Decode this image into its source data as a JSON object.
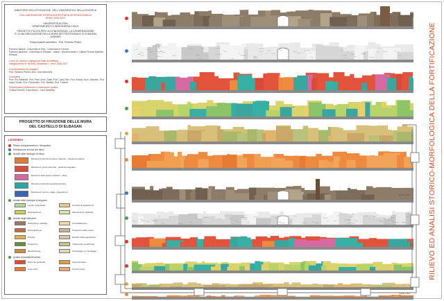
{
  "info": {
    "ministry": "MINISTERO DELL'ISTRUZIONE, DELL'UNIVERSITÀ E DELLA RICERCA",
    "collab_title": "COLLABORAZIONE INTERUNIVERSITARIA INTERNAZIONALE",
    "collab_year": "ANNO 2006-2007",
    "uni": "UNIVERSITÀ DI PISA",
    "dept": "DIPARTIMENTO DI INGEGNERIA CIVILE",
    "project_l1": "PROGETTO PILOTA PER LA CONOSCENZA, LA CONSERVAZIONE",
    "project_l2": "E LA VALORIZZAZIONE DELLA MURA SETTENTRIONALE DI ELBASAN",
    "project_l3": "- ALBANIA -",
    "resp": "Responsabile scientifico : Prof. Roberto Pierini",
    "partner_it": "Partners italiani : Università di Pisa - Università di Firenze",
    "partner_al": "Partners albanesi : Università di Elbasan - Istituti - Monumentale e Cultura Pisarra Mobilità - Elbasan",
    "course": "Corso di Laurea in Ingegneria Edile Architettura",
    "course2": "Insegnamento di Tecnica Urbanistica I - anno 2006-2007",
    "coord_hdr": "Coordinamento del progetto",
    "coord": "Prof. Roberto Pierini, Arch. Ivan Marchesi",
    "consult_hdr": "Consulenti",
    "consult": "Prof. Pio Saltarelli, Prof. Pani, Arch. Gatti, Prof. Carlo Ren, Prof. Bocca, Arch. Marrello, Prof. Ivano Scalzi, Prof. Pierandrei, Prof. Battisti, Prof. Tiratore",
    "prep_hdr": "Preparazione preliminare e restituzione grafica",
    "prep": "Chiara Erbolini, Francesca L. Luisi Samuele"
  },
  "project_title_l1": "PROGETTO DI FRUIZIONE DELLE MURA",
  "project_title_l2": "DEL CASTELLO DI ELBASAN",
  "legend": {
    "title": "LEGENDA",
    "dots": [
      {
        "label": "Rilievo fotogrammetrico / fotografico",
        "color": "#d33a2c"
      },
      {
        "label": "Restituzione tecnica dei rilievi",
        "color": "#3a77c4"
      },
      {
        "label": "Analisi delle tipologie di rilievo",
        "color": "#43a047"
      }
    ],
    "blocks": [
      {
        "color": "#e07a3a",
        "text": "Muratura in blocchi di pietra e laterizio - tessitura regolare"
      },
      {
        "color": "#d94a3a",
        "text": "Muratura in pietre sbozzate - tessitura irregolare"
      },
      {
        "color": "#d66aa0",
        "text": "Muratura mista pietra e laterizio - fasce"
      },
      {
        "color": "#2aa6a8",
        "text": "Muratura in blocchi squadrati di pietra"
      },
      {
        "color": "#3a64b0",
        "text": "Muratura in pietra e malta - integrazioni"
      }
    ],
    "degrado_hdr": "Analisi delle tipologie di degrado",
    "degrado": [
      {
        "a": "Lacune superficiali",
        "ca": "#b9d79a",
        "b": "Crescita di vegetazione",
        "cb": "#e8c98a"
      },
      {
        "a": "Disgregazione",
        "ca": "#c7d35a",
        "b": "Mancanza di materiale",
        "cb": "#d7e6a3"
      }
    ],
    "int_hdr": "Analisi degli interventi",
    "interventi": [
      {
        "a": "Stuccatura e stilatura",
        "ca": "#9e7a62",
        "b": "Consolidamento",
        "cb": "#f2d7b0"
      },
      {
        "a": "Reintegrazione",
        "ca": "#c56a3a",
        "b": "Protezione delle creste",
        "cb": "#cbb48a"
      },
      {
        "a": "Pulitura",
        "ca": "#e6b04a",
        "b": "Diserbo della vegetazione",
        "cb": "#d4c9b0"
      },
      {
        "a": "Protezione",
        "ca": "#6a8f3a",
        "b": "Trattamento superficiale",
        "cb": "#b8c98e"
      },
      {
        "a": "Ricostruzione",
        "ca": "#d98840",
        "b": "Smontaggio e rimontaggio",
        "cb": "#e7d6b2"
      }
    ],
    "usage_hdr": "Ipotesi di possibili fruizioni",
    "usage": [
      {
        "a": "Percorso pedonale",
        "ca": "#e24a2a",
        "b": "Area belvedere",
        "cb": "#d7a23a"
      },
      {
        "a": "Aree verdi",
        "ca": "#f07a2a",
        "b": "Punti di sosta",
        "cb": "#eca96a"
      }
    ]
  },
  "vertical_title": "RILIEVO ED ANALISI STORICO-MORFOLOGICA DELLA FORTIFICAZIONE",
  "scale_1": "Scala 1:250",
  "scale_2": "Scala 1:500",
  "colors": {
    "accent_red": "#e04a1f",
    "photo": "#8d7c68",
    "line_drawing": "#bdbdbd",
    "survey_red": "#e2533b",
    "survey_teal": "#36b0a5",
    "survey_green": "#7cb342",
    "survey_orange": "#ee8a3f"
  },
  "strips": [
    {
      "kind": "photo",
      "dot": "#d33a2c"
    },
    {
      "kind": "drawing",
      "dot": "#3a77c4"
    },
    {
      "kind": "materials",
      "dot": "#d33a2c"
    },
    {
      "kind": "degrado",
      "dot": "#43a047"
    },
    {
      "kind": "degrado2",
      "dot": "#e0a23a"
    },
    {
      "kind": "orange",
      "dot": "#ee8a3f"
    },
    {
      "kind": "photo",
      "dot": "#3a77c4"
    },
    {
      "kind": "drawing",
      "dot": "#43a047"
    },
    {
      "kind": "materials",
      "dot": "#d33a2c"
    },
    {
      "kind": "degrado",
      "dot": "#d33a2c"
    },
    {
      "kind": "degrado2",
      "dot": "#e0a23a"
    },
    {
      "kind": "orange",
      "dot": "#ee8a3f"
    }
  ]
}
